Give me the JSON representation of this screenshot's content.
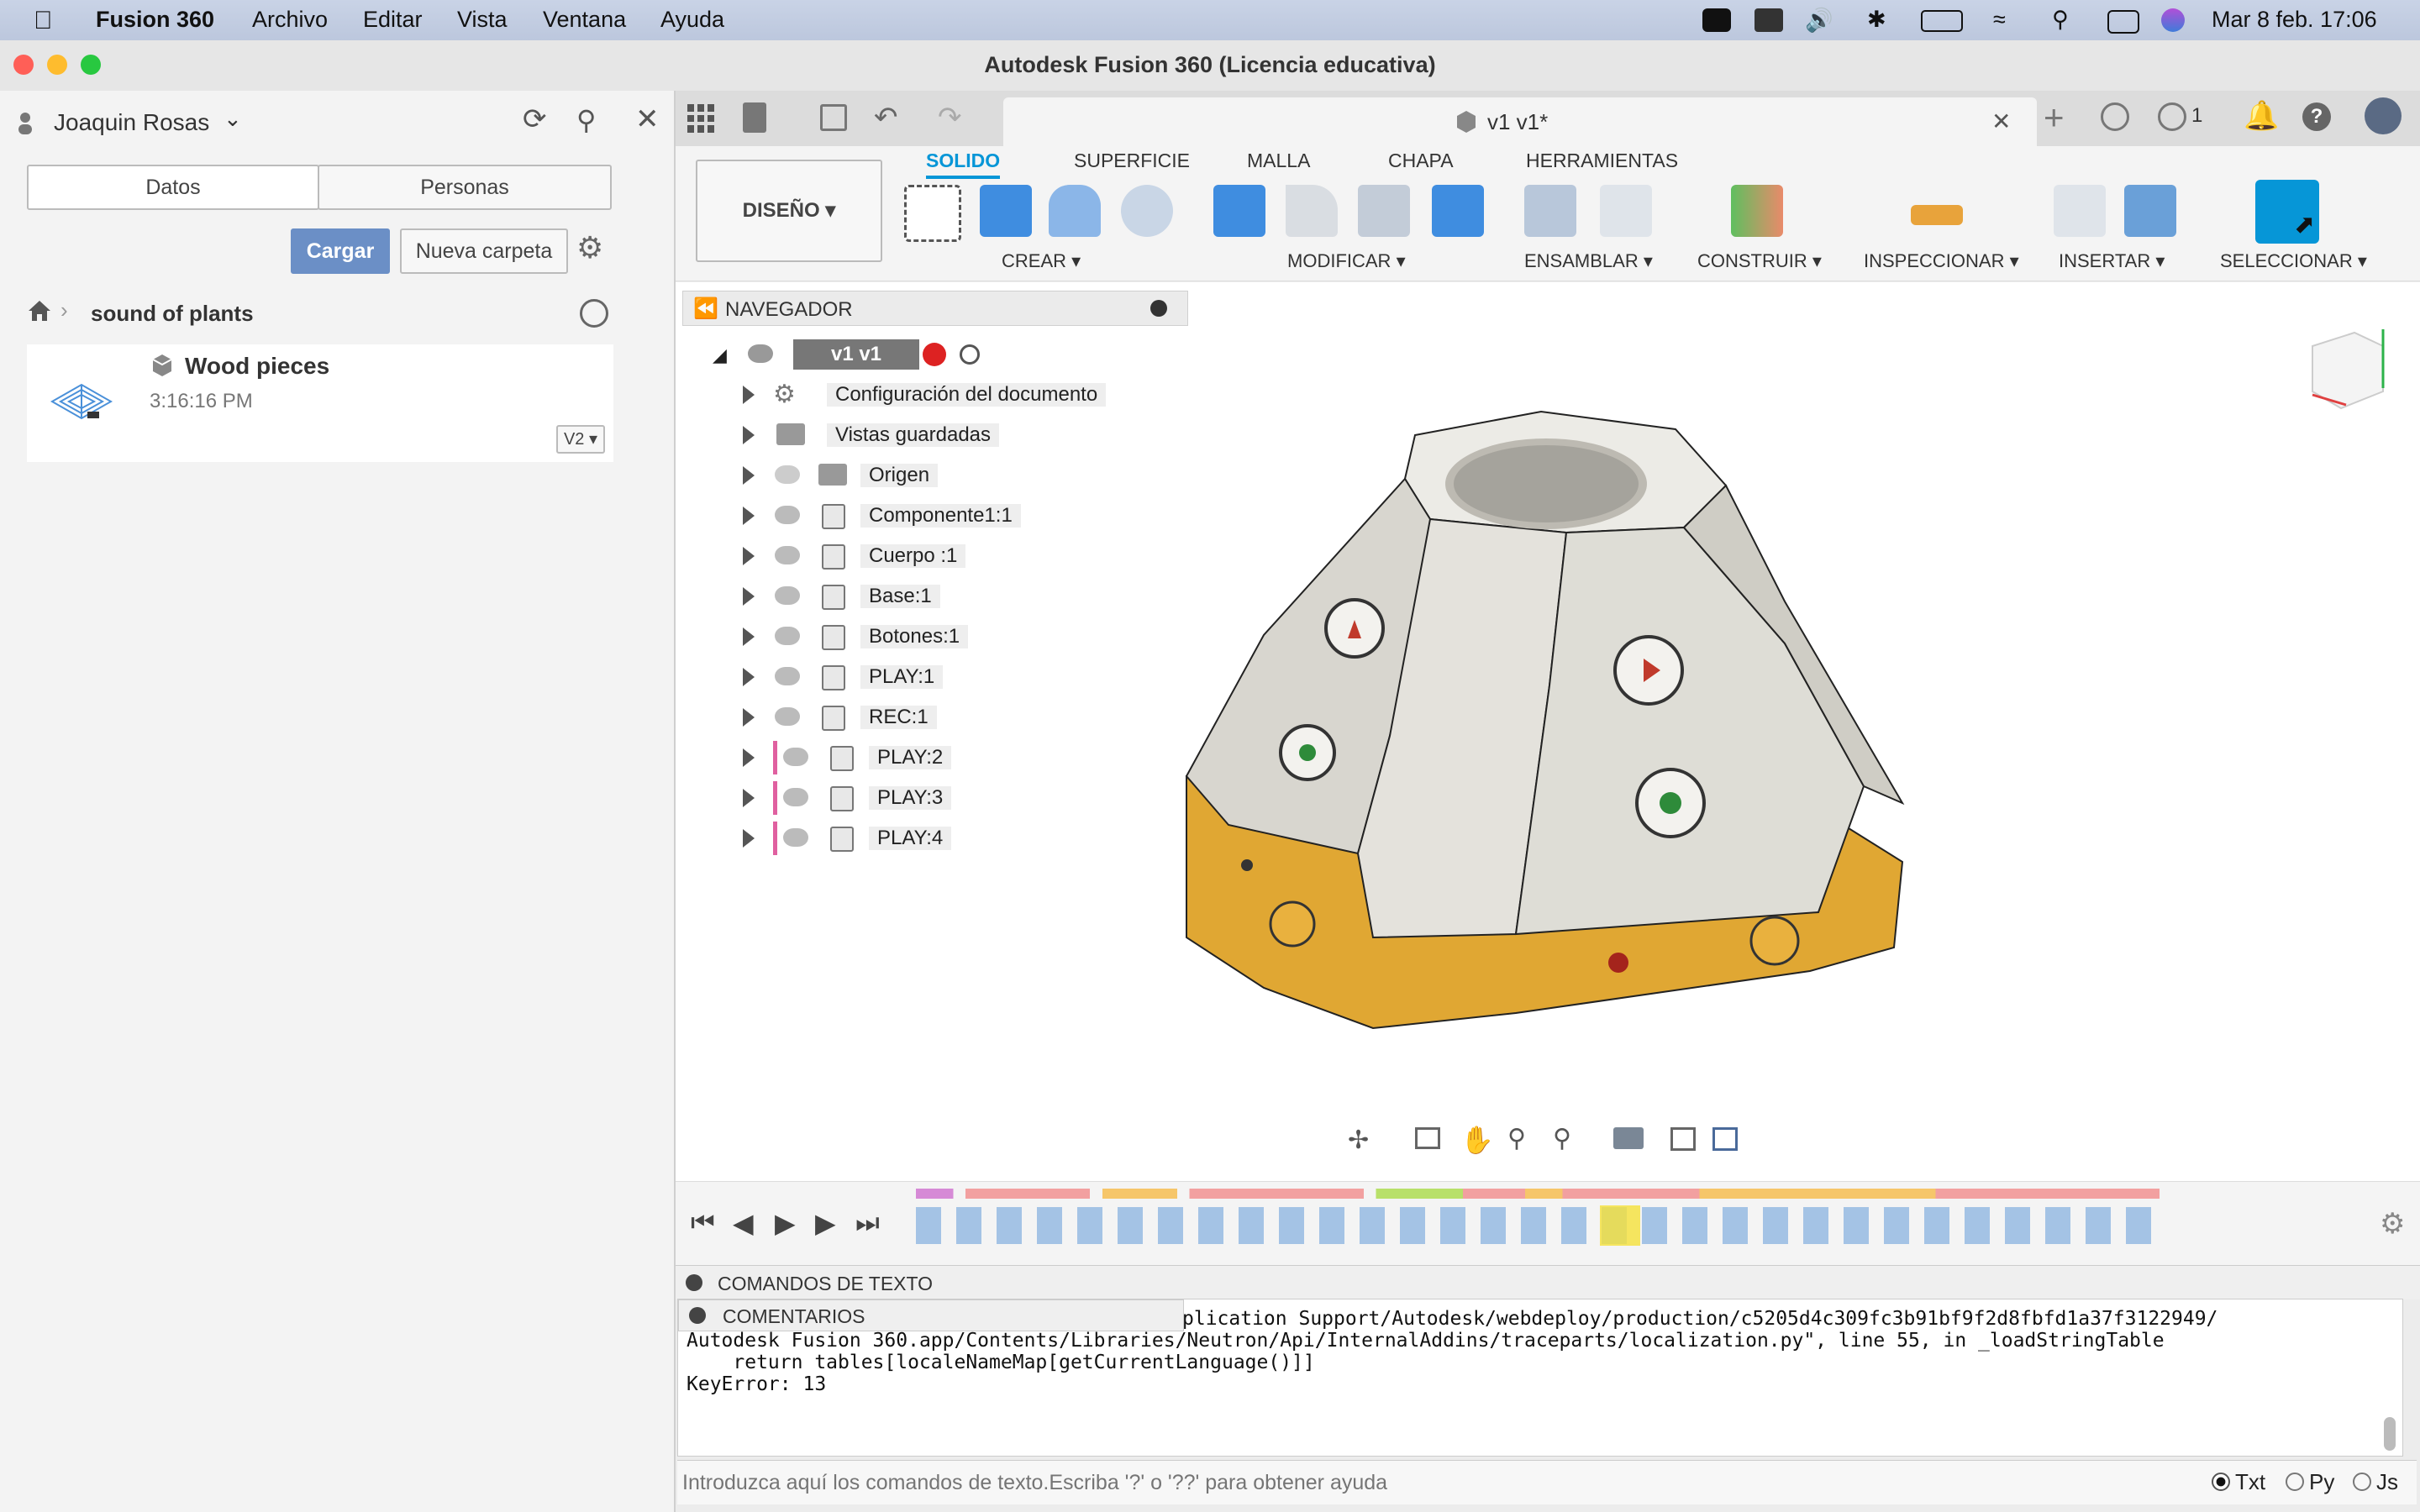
{
  "menubar": {
    "app_name": "Fusion 360",
    "items": [
      "Archivo",
      "Editar",
      "Vista",
      "Ventana",
      "Ayuda"
    ],
    "clock": "Mar 8 feb.  17:06"
  },
  "window": {
    "title": "Autodesk Fusion 360 (Licencia educativa)"
  },
  "data_panel": {
    "user": "Joaquin Rosas",
    "tabs": [
      "Datos",
      "Personas"
    ],
    "upload_label": "Cargar",
    "new_folder_label": "Nueva carpeta",
    "breadcrumb": "sound of plants",
    "file": {
      "name": "Wood pieces",
      "time": "3:16:16 PM",
      "version": "V2"
    }
  },
  "doc_tab": {
    "title": "v1 v1*",
    "job_count": "1"
  },
  "toolbar": {
    "workspace": "DISEÑO",
    "tabs": [
      "SOLIDO",
      "SUPERFICIE",
      "MALLA",
      "CHAPA",
      "HERRAMIENTAS"
    ],
    "groups": [
      "CREAR",
      "MODIFICAR",
      "ENSAMBLAR",
      "CONSTRUIR",
      "INSPECCIONAR",
      "INSERTAR",
      "SELECCIONAR"
    ]
  },
  "browser": {
    "title": "NAVEGADOR",
    "root": "v1 v1",
    "items": [
      "Configuración del documento",
      "Vistas guardadas",
      "Origen",
      "Componente1:1",
      "Cuerpo :1",
      "Base:1",
      "Botones:1",
      "PLAY:1",
      "REC:1",
      "PLAY:2",
      "PLAY:3",
      "PLAY:4"
    ]
  },
  "text_commands": {
    "title": "COMENTARIOS",
    "header": "COMANDOS DE TEXTO",
    "lines": [
      "plication Support/Autodesk/webdeploy/production/c5205d4c309fc3b91bf9f2d8fbfd1a37f3122949/",
      "Autodesk Fusion 360.app/Contents/Libraries/Neutron/Api/InternalAddins/traceparts/localization.py\", line 55, in _loadStringTable",
      "    return tables[localeNameMap[getCurrentLanguage()]]",
      "KeyError: 13"
    ],
    "placeholder": "Introduzca aquí los comandos de texto.Escriba '?' o '??' para obtener ayuda",
    "modes": [
      "Txt",
      "Py",
      "Js"
    ]
  },
  "colors": {
    "accent": "#0696d7",
    "upload": "#6b8fc6",
    "body_wood": "#e8e4dc",
    "base_orange": "#e0a733"
  }
}
